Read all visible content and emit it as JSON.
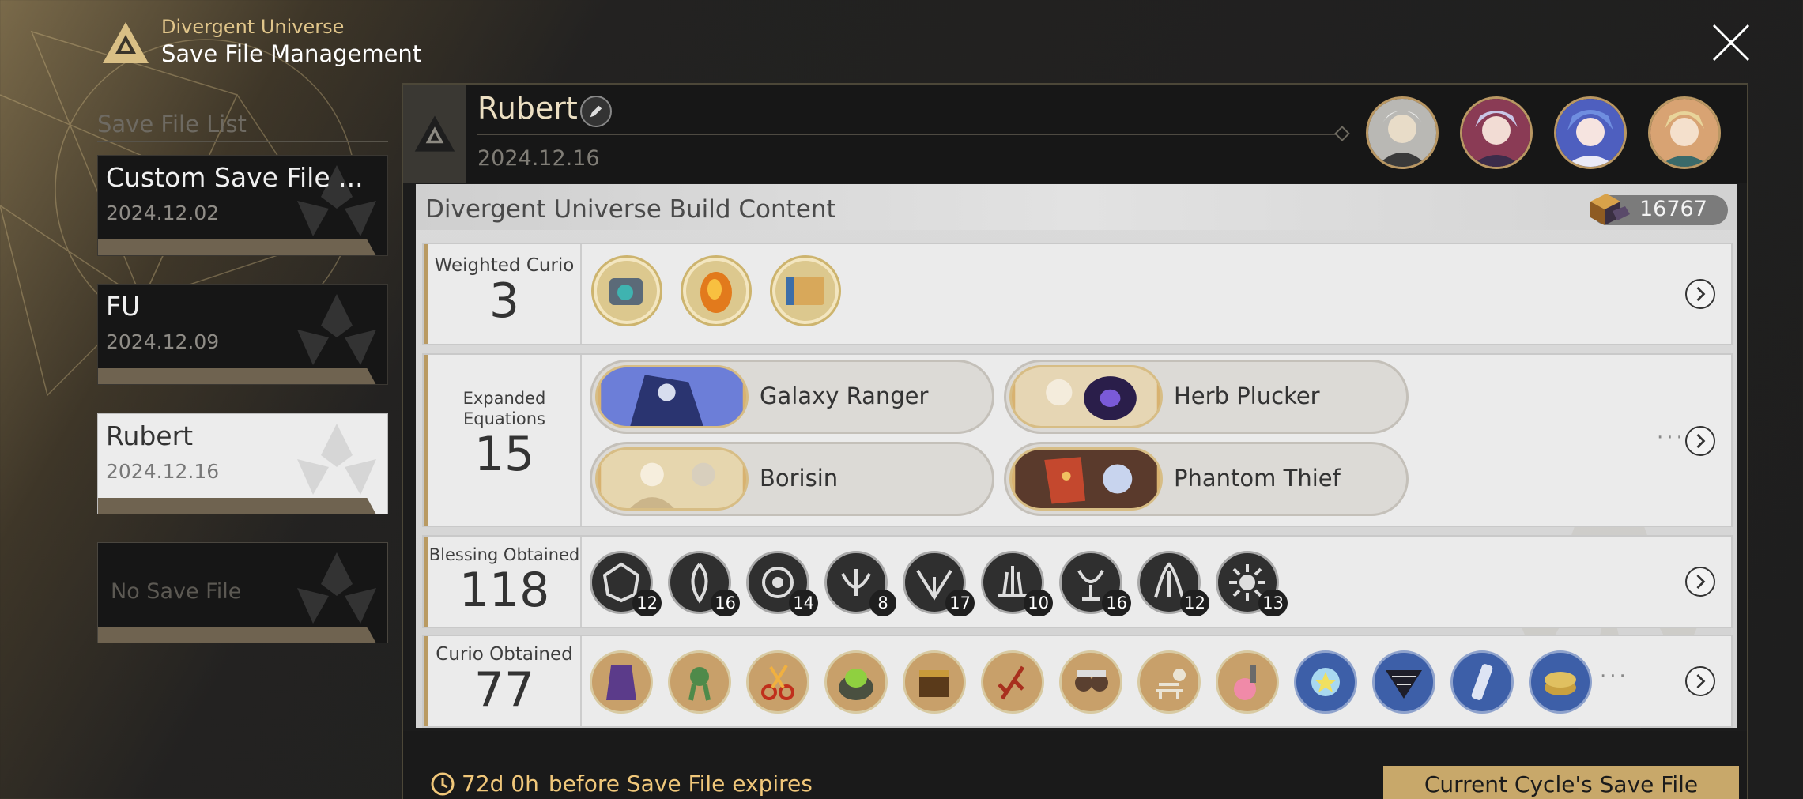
{
  "header": {
    "subtitle": "Divergent Universe",
    "title": "Save File Management"
  },
  "save_list": {
    "title": "Save File List",
    "items": [
      {
        "name": "Custom Save File ...",
        "date": "2024.12.02"
      },
      {
        "name": "FU",
        "date": "2024.12.09"
      },
      {
        "name": "Rubert",
        "date": "2024.12.16"
      },
      {
        "empty_label": "No Save File"
      }
    ]
  },
  "detail": {
    "name": "Rubert",
    "date": "2024.12.16",
    "content_title": "Divergent Universe Build Content",
    "cosmic_fragments": "16767",
    "weighted_curio": {
      "label": "Weighted Curio",
      "count": "3"
    },
    "expanded_equations": {
      "label_line1": "Expanded",
      "label_line2": "Equations",
      "count": "15",
      "items": [
        "Galaxy Ranger",
        "Herb Plucker",
        "Borisin",
        "Phantom Thief"
      ]
    },
    "blessings": {
      "label": "Blessing Obtained",
      "count": "118",
      "counts": [
        "12",
        "16",
        "14",
        "8",
        "17",
        "10",
        "16",
        "12",
        "13"
      ]
    },
    "curios": {
      "label": "Curio Obtained",
      "count": "77"
    },
    "expiry": {
      "time": "72d 0h",
      "text": "before Save File expires"
    },
    "cycle_button": "Current Cycle's Save File"
  },
  "colors": {
    "accent_gold": "#c8a86a",
    "text_gold": "#f0c77a",
    "panel_dark": "#1c1c1c",
    "content_light": "#ebebeb"
  },
  "icons": [
    "triangle-emblem-icon",
    "close-icon",
    "edit-pencil-icon",
    "chevron-right-icon",
    "clock-icon",
    "cosmic-fragment-icon"
  ]
}
